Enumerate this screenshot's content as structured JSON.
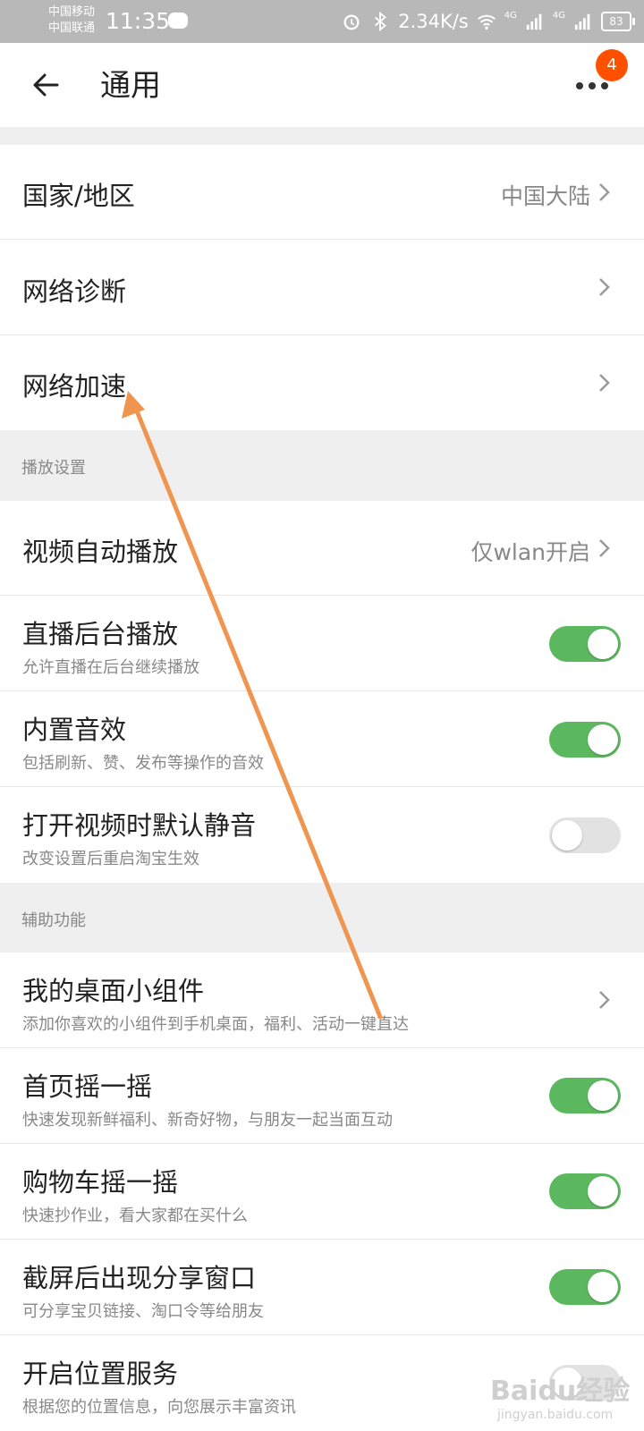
{
  "status_bar": {
    "carrier1": "中国移动",
    "carrier2": "中国联通",
    "time": "11:35",
    "speed": "2.34K/s",
    "battery": "83",
    "network1": "4G",
    "network2": "4G"
  },
  "header": {
    "title": "通用",
    "badge": "4",
    "back_icon": "arrow-left-icon",
    "more_icon": "more-dots-icon"
  },
  "general": {
    "country": {
      "label": "国家/地区",
      "value": "中国大陆"
    },
    "diagnosis": {
      "label": "网络诊断"
    },
    "acceleration": {
      "label": "网络加速"
    }
  },
  "playback": {
    "header": "播放设置",
    "autoplay": {
      "label": "视频自动播放",
      "value": "仅wlan开启"
    },
    "live_bg": {
      "label": "直播后台播放",
      "desc": "允许直播在后台继续播放",
      "on": true
    },
    "sound": {
      "label": "内置音效",
      "desc": "包括刷新、赞、发布等操作的音效",
      "on": true
    },
    "mute": {
      "label": "打开视频时默认静音",
      "desc": "改变设置后重启淘宝生效",
      "on": false
    }
  },
  "assist": {
    "header": "辅助功能",
    "widget": {
      "label": "我的桌面小组件",
      "desc": "添加你喜欢的小组件到手机桌面，福利、活动一键直达"
    },
    "shake_home": {
      "label": "首页摇一摇",
      "desc": "快速发现新鲜福利、新奇好物，与朋友一起当面互动",
      "on": true
    },
    "shake_cart": {
      "label": "购物车摇一摇",
      "desc": "快速抄作业，看大家都在买什么",
      "on": true
    },
    "screenshot_share": {
      "label": "截屏后出现分享窗口",
      "desc": "可分享宝贝链接、淘口令等给朋友",
      "on": true
    },
    "location": {
      "label": "开启位置服务",
      "desc": "根据您的位置信息，向您展示丰富资讯",
      "on": false
    }
  },
  "watermark": {
    "logo": "Baidu经验",
    "url": "jingyan.baidu.com"
  },
  "colors": {
    "toggle_on": "#5cb85f",
    "badge": "#ff5000",
    "arrow": "#f0954f"
  }
}
